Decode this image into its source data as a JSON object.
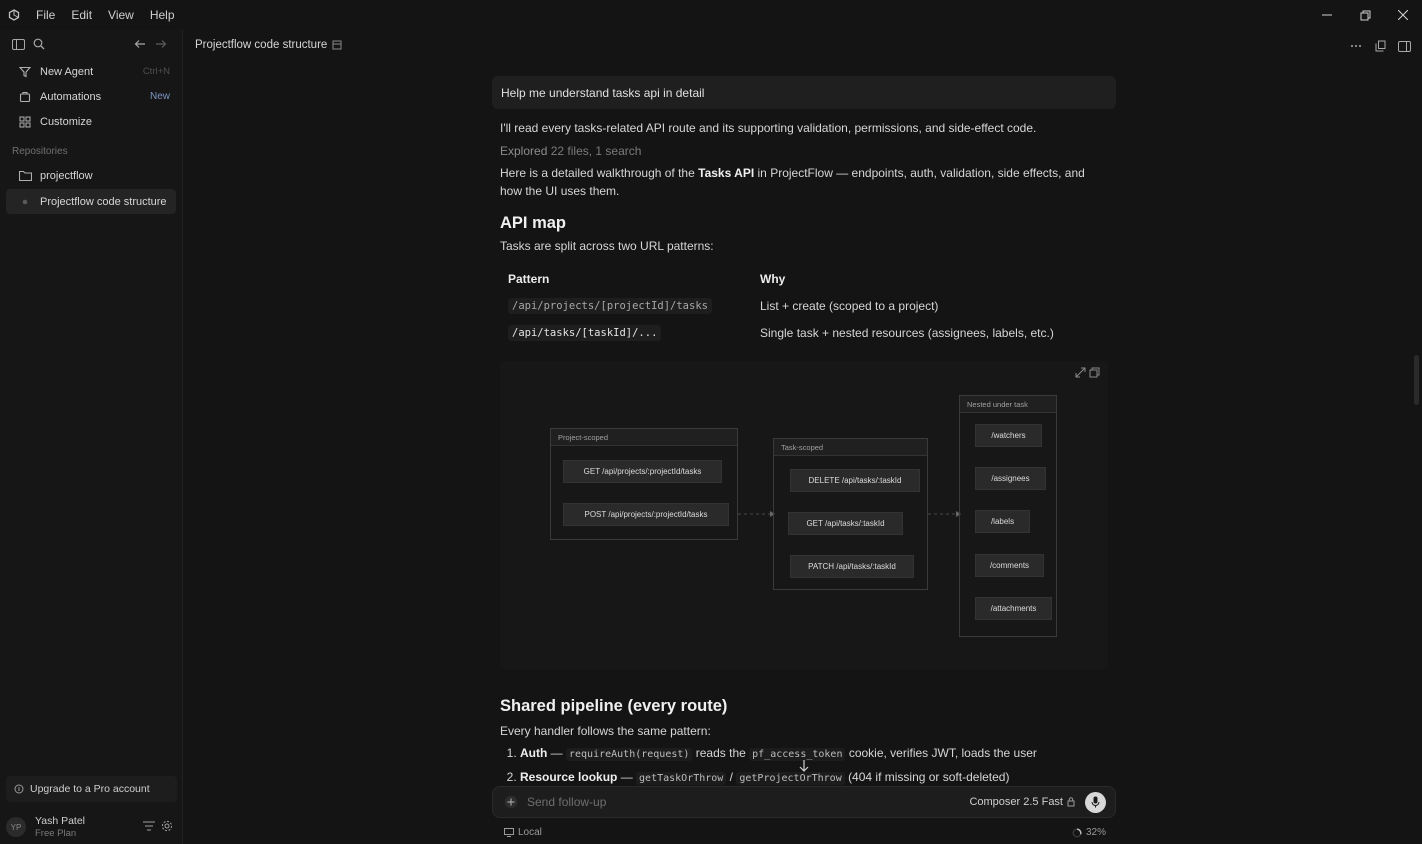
{
  "menu": {
    "file": "File",
    "edit": "Edit",
    "view": "View",
    "help": "Help"
  },
  "sidebar": {
    "new_agent": {
      "label": "New Agent",
      "shortcut": "Ctrl+N"
    },
    "automations": {
      "label": "Automations",
      "badge": "New"
    },
    "customize": {
      "label": "Customize"
    },
    "repos_heading": "Repositories",
    "repo": {
      "label": "projectflow"
    },
    "chat": {
      "label": "Projectflow code structure"
    },
    "upgrade": "Upgrade to a Pro account",
    "user": {
      "initials": "YP",
      "name": "Yash Patel",
      "plan": "Free Plan"
    }
  },
  "header": {
    "title": "Projectflow code structure"
  },
  "conversation": {
    "prompt": "Help me understand tasks api in detail",
    "intro": "I'll read every tasks-related API route and its supporting validation, permissions, and side-effect code.",
    "explored_prefix": "Explored",
    "explored_detail": "22 files, 1 search",
    "walk_a": "Here is a detailed walkthrough of the",
    "walk_b": "Tasks API",
    "walk_c": "in ProjectFlow — endpoints, auth, validation, side effects, and how the UI uses them.",
    "api_map_heading": "API map",
    "api_map_sub": "Tasks are split across two URL patterns:",
    "table": {
      "col_pattern": "Pattern",
      "col_why": "Why",
      "rows": [
        {
          "pattern": "/api/projects/[projectId]/tasks",
          "why": "List + create (scoped to a project)"
        },
        {
          "pattern": "/api/tasks/[taskId]/...",
          "why": "Single task + nested resources (assignees, labels, etc.)"
        }
      ]
    },
    "diagram": {
      "project_scoped": {
        "title": "Project-scoped",
        "nodes": [
          "GET /api/projects/:projectId/tasks",
          "POST /api/projects/:projectId/tasks"
        ]
      },
      "task_scoped": {
        "title": "Task-scoped",
        "nodes": [
          "DELETE /api/tasks/:taskId",
          "GET /api/tasks/:taskId",
          "PATCH /api/tasks/:taskId"
        ]
      },
      "nested": {
        "title": "Nested under task",
        "nodes": [
          "/watchers",
          "/assignees",
          "/labels",
          "/comments",
          "/attachments"
        ]
      }
    },
    "pipeline_heading": "Shared pipeline (every route)",
    "pipeline_sub": "Every handler follows the same pattern:",
    "steps": [
      {
        "title": "Auth",
        "code1": "requireAuth(request)",
        "mid": "reads the",
        "code2": "pf_access_token",
        "rest": "cookie, verifies JWT, loads the user"
      },
      {
        "title": "Resource lookup",
        "code1": "getTaskOrThrow",
        "sep": "/",
        "code2": "getProjectOrThrow",
        "rest": "(404 if missing or soft-deleted)"
      }
    ]
  },
  "composer": {
    "placeholder": "Send follow-up",
    "model": "Composer 2.5 Fast"
  },
  "footer": {
    "local": "Local",
    "context": "32%"
  }
}
